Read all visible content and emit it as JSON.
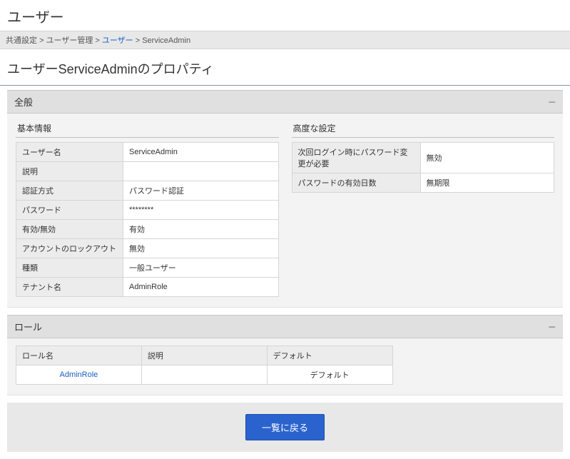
{
  "page": {
    "title": "ユーザー",
    "heading": "ユーザーServiceAdminのプロパティ"
  },
  "breadcrumb": {
    "items": [
      "共通設定",
      "ユーザー管理",
      "ユーザー",
      "ServiceAdmin"
    ],
    "link_index": 2,
    "separator": " > "
  },
  "general": {
    "panel_title": "全般",
    "basic": {
      "title": "基本情報",
      "rows": [
        {
          "label": "ユーザー名",
          "value": "ServiceAdmin"
        },
        {
          "label": "説明",
          "value": ""
        },
        {
          "label": "認証方式",
          "value": "パスワード認証"
        },
        {
          "label": "パスワード",
          "value": "********"
        },
        {
          "label": "有効/無効",
          "value": "有効"
        },
        {
          "label": "アカウントのロックアウト",
          "value": "無効"
        },
        {
          "label": "種類",
          "value": "一般ユーザー"
        },
        {
          "label": "テナント名",
          "value": "AdminRole"
        }
      ]
    },
    "advanced": {
      "title": "高度な設定",
      "rows": [
        {
          "label": "次回ログイン時にパスワード変更が必要",
          "value": "無効"
        },
        {
          "label": "パスワードの有効日数",
          "value": "無期限"
        }
      ]
    }
  },
  "roles": {
    "panel_title": "ロール",
    "headers": [
      "ロール名",
      "説明",
      "デフォルト"
    ],
    "rows": [
      {
        "name": "AdminRole",
        "desc": "",
        "default": "デフォルト",
        "link": true
      }
    ]
  },
  "footer": {
    "back_label": "一覧に戻る"
  }
}
